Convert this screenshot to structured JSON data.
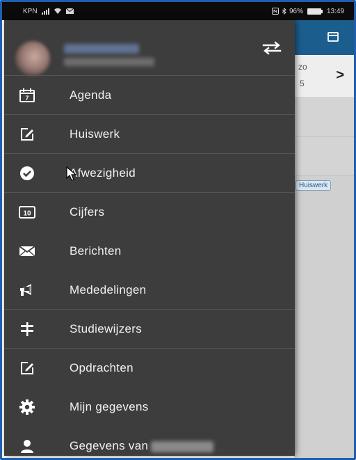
{
  "status_bar": {
    "carrier": "KPN",
    "battery": "96%",
    "time": "13:49"
  },
  "background_app": {
    "day_abbrev": "zo",
    "day_number": "5",
    "badge": "Huiswerk"
  },
  "menu": {
    "items": [
      {
        "label": "Agenda",
        "icon": "calendar-icon"
      },
      {
        "label": "Huiswerk",
        "icon": "edit-icon"
      },
      {
        "label": "Afwezigheid",
        "icon": "check-circle-icon"
      },
      {
        "label": "Cijfers",
        "icon": "grade-icon",
        "icon_text": "10"
      },
      {
        "label": "Berichten",
        "icon": "envelope-icon"
      },
      {
        "label": "Mededelingen",
        "icon": "megaphone-icon"
      },
      {
        "label": "Studiewijzers",
        "icon": "signpost-icon"
      },
      {
        "label": "Opdrachten",
        "icon": "edit-icon"
      },
      {
        "label": "Mijn gegevens",
        "icon": "gear-icon"
      },
      {
        "label": "Gegevens van",
        "icon": "person-icon"
      }
    ]
  },
  "colors": {
    "drawer_bg": "#3d3d3d",
    "toolbar_blue": "#1b5e8e",
    "border_blue": "#1f5fae"
  }
}
